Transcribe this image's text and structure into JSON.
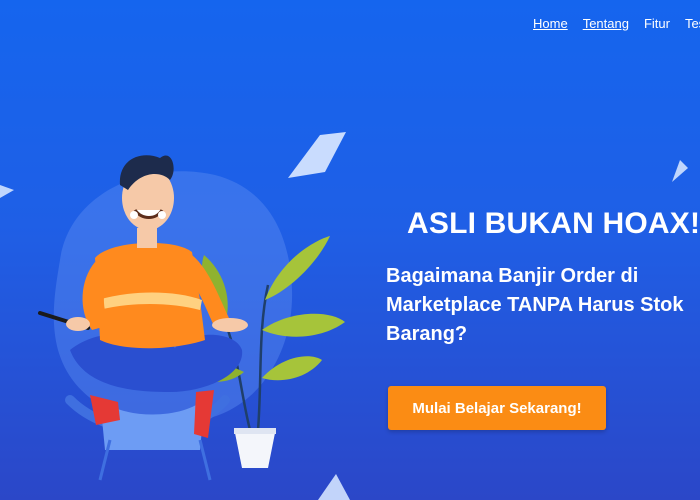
{
  "nav": {
    "items": [
      {
        "label": "Home"
      },
      {
        "label": "Tentang"
      },
      {
        "label": "Fitur"
      },
      {
        "label": "Testimoni"
      }
    ]
  },
  "hero": {
    "headline": "ASLI BUKAN HOAX!",
    "subheadline": "Bagaimana Banjir Order di Marketplace TANPA Harus Stok Barang?",
    "cta_label": "Mulai Belajar Sekarang!"
  },
  "colors": {
    "background": "#1565ee",
    "cta": "#fb8c14"
  },
  "icons": [
    "paper-plane-icon",
    "meditating-person-illustration",
    "potted-plant-illustration"
  ]
}
